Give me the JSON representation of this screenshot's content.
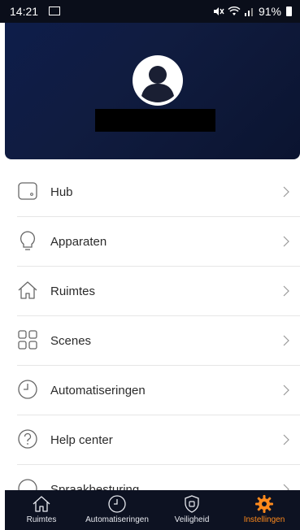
{
  "status": {
    "time": "14:21",
    "battery": "91%"
  },
  "menu": {
    "items": [
      {
        "label": "Hub",
        "icon": "hub-icon"
      },
      {
        "label": "Apparaten",
        "icon": "lightbulb-icon"
      },
      {
        "label": "Ruimtes",
        "icon": "house-icon"
      },
      {
        "label": "Scenes",
        "icon": "scenes-grid-icon"
      },
      {
        "label": "Automatiseringen",
        "icon": "clock-icon"
      },
      {
        "label": "Help center",
        "icon": "help-icon"
      },
      {
        "label": "Spraakbesturing",
        "icon": "voice-icon"
      }
    ]
  },
  "nav": {
    "items": [
      {
        "label": "Ruimtes",
        "icon": "house-icon"
      },
      {
        "label": "Automatiseringen",
        "icon": "clock-icon"
      },
      {
        "label": "Veiligheid",
        "icon": "shield-icon"
      },
      {
        "label": "Instellingen",
        "icon": "gear-icon",
        "active": true
      }
    ]
  },
  "colors": {
    "accent": "#ff8a1c",
    "nav_bg": "#0d1222",
    "header_bg": "#0e1d4a"
  }
}
